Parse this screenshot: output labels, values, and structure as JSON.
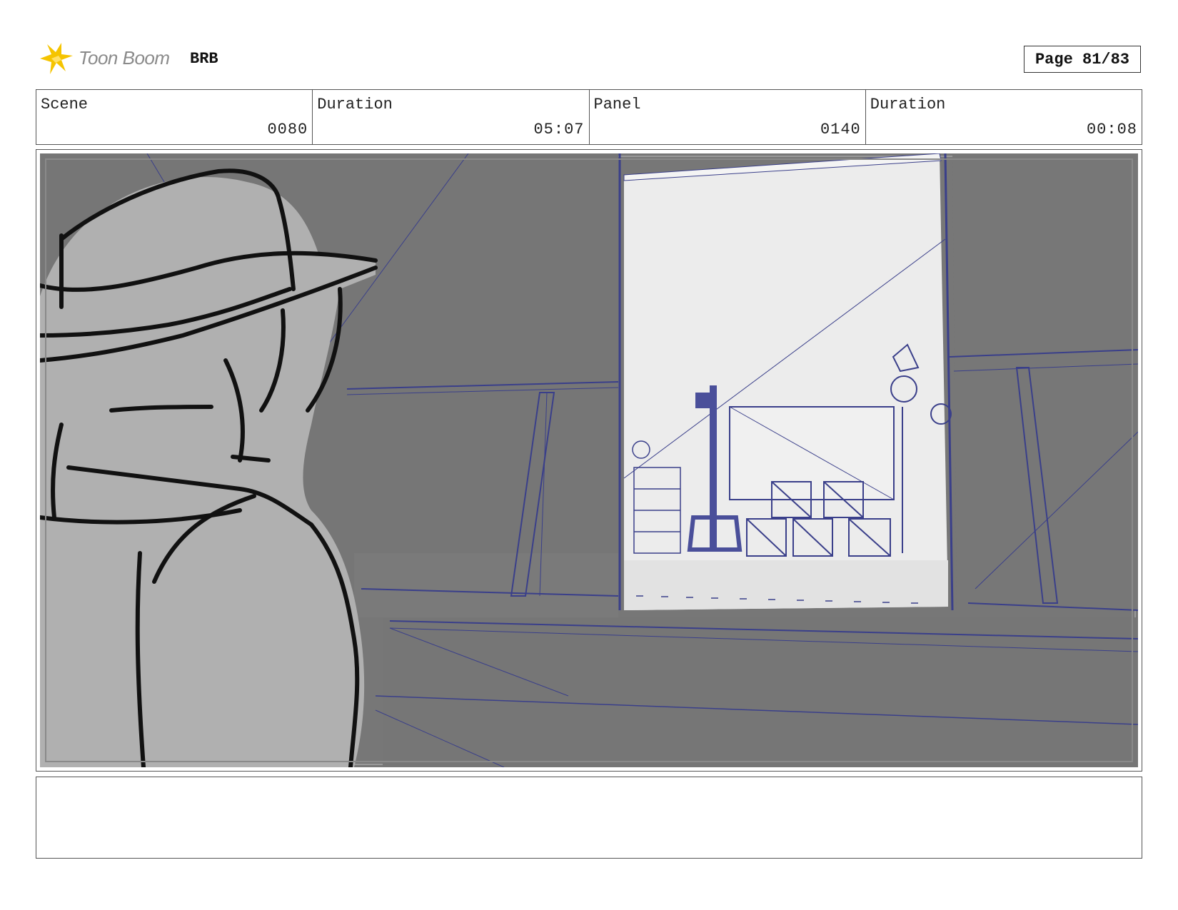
{
  "header": {
    "logo_text": "Toon Boom",
    "project": "BRB",
    "page": "Page 81/83"
  },
  "info": {
    "scene_label": "Scene",
    "scene_value": "0080",
    "scene_duration_label": "Duration",
    "scene_duration_value": "05:07",
    "panel_label": "Panel",
    "panel_value": "0140",
    "panel_duration_label": "Duration",
    "panel_duration_value": "00:08"
  },
  "colors": {
    "logo_yellow": "#f5c400",
    "wall_gray": "#777777",
    "figure_gray": "#b0b0b0",
    "room_light": "#ececec",
    "wireframe_blue": "#3a3f8a"
  },
  "notes": ""
}
